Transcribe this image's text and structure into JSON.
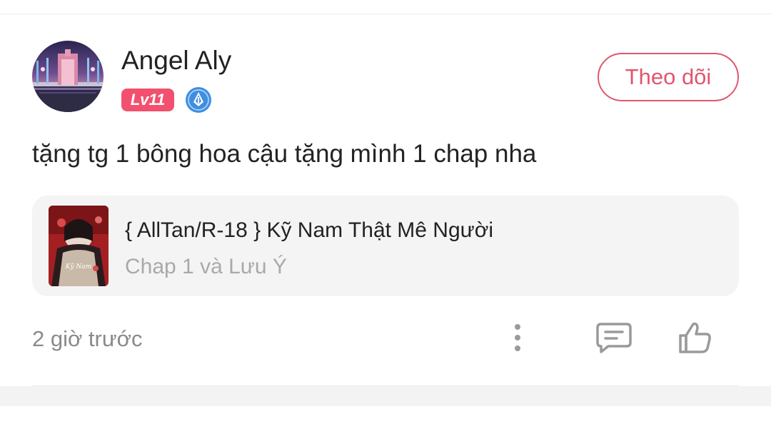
{
  "comment": {
    "user": {
      "name": "Angel Aly",
      "level": "Lv11",
      "avatar_icon": "avatar-image",
      "badge_icon": "author-pen-badge-icon"
    },
    "follow_label": "Theo dõi",
    "text": "tặng tg 1 bông hoa cậu tặng mình 1 chap nha",
    "story": {
      "title": "{ AllTan/R-18 } Kỹ Nam Thật Mê Người",
      "chapter": "Chap 1 và Lưu Ý",
      "cover_icon": "story-cover-image"
    },
    "timestamp": "2 giờ trước",
    "actions": {
      "more_icon": "more-vertical-icon",
      "reply_icon": "comment-icon",
      "like_icon": "thumbs-up-icon"
    }
  },
  "colors": {
    "accent": "#e0566e",
    "level_badge": "#f2506e",
    "text_primary": "#222222",
    "text_secondary": "#8a8a8a",
    "card_background": "#f4f4f4",
    "icon_gray": "#9a9a9a"
  }
}
